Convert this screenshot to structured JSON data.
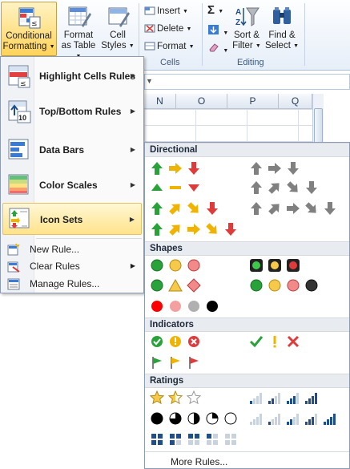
{
  "ribbon": {
    "conditional_formatting": {
      "line1": "Conditional",
      "line2": "Formatting"
    },
    "format_as_table": {
      "line1": "Format",
      "line2": "as Table"
    },
    "cell_styles": {
      "line1": "Cell",
      "line2": "Styles"
    },
    "insert": "Insert",
    "delete": "Delete",
    "format": "Format",
    "cells_group": "Cells",
    "sum_symbol": "Σ",
    "sort_filter": {
      "line1": "Sort &",
      "line2": "Filter"
    },
    "find_select": {
      "line1": "Find &",
      "line2": "Select"
    },
    "editing_group": "Editing"
  },
  "sheet": {
    "columns": [
      "N",
      "O",
      "P",
      "Q"
    ]
  },
  "menu": {
    "items": [
      {
        "label": "Highlight Cells Rules",
        "icon": "highlight-cells-icon"
      },
      {
        "label": "Top/Bottom Rules",
        "icon": "top-bottom-icon"
      },
      {
        "label": "Data Bars",
        "icon": "data-bars-icon"
      },
      {
        "label": "Color Scales",
        "icon": "color-scales-icon"
      },
      {
        "label": "Icon Sets",
        "icon": "icon-sets-icon"
      }
    ],
    "new_rule": "New Rule...",
    "clear_rules": "Clear Rules",
    "manage_rules": "Manage Rules...",
    "top_bottom_badge": "10"
  },
  "gallery": {
    "sections": [
      "Directional",
      "Shapes",
      "Indicators",
      "Ratings"
    ],
    "more_rules": "More Rules...",
    "colors": {
      "green": "#2aa23a",
      "yellow": "#f0b400",
      "red": "#e03b3b",
      "gray": "#808080",
      "blue": "#1f4e8c"
    }
  }
}
